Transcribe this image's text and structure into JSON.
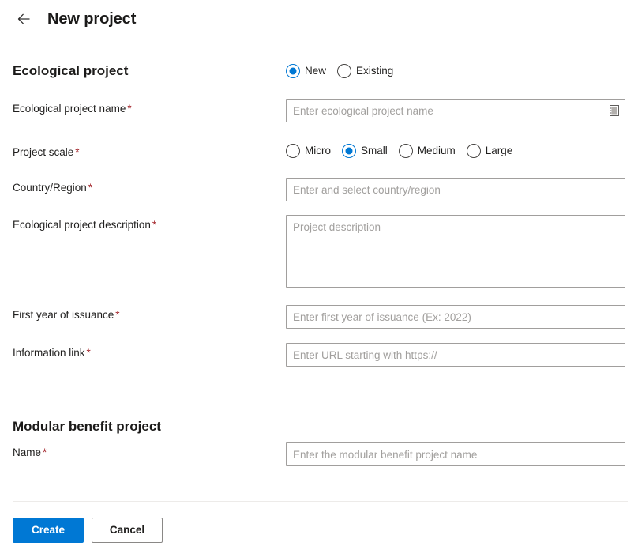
{
  "header": {
    "back_icon": "arrow-left-icon",
    "title": "New project"
  },
  "sections": {
    "ecological": {
      "heading": "Ecological project",
      "mode_radio": {
        "name": "ecological-mode",
        "options": [
          {
            "label": "New",
            "selected": true
          },
          {
            "label": "Existing",
            "selected": false
          }
        ]
      },
      "fields": {
        "project_name": {
          "label": "Ecological project name",
          "required_mark": "*",
          "value": "",
          "placeholder": "Enter ecological project name",
          "trailing_icon": "book-contacts-icon"
        },
        "project_scale": {
          "label": "Project scale",
          "required_mark": "*",
          "options": [
            {
              "label": "Micro",
              "selected": false
            },
            {
              "label": "Small",
              "selected": true
            },
            {
              "label": "Medium",
              "selected": false
            },
            {
              "label": "Large",
              "selected": false
            }
          ]
        },
        "country_region": {
          "label": "Country/Region",
          "required_mark": "*",
          "value": "",
          "placeholder": "Enter and select country/region"
        },
        "description": {
          "label": "Ecological project description",
          "required_mark": "*",
          "value": "",
          "placeholder": "Project description"
        },
        "first_year": {
          "label": "First year of issuance",
          "required_mark": "*",
          "value": "",
          "placeholder": "Enter first year of issuance (Ex: 2022)"
        },
        "information_link": {
          "label": "Information link",
          "required_mark": "*",
          "value": "",
          "placeholder": "Enter URL starting with https://"
        }
      }
    },
    "modular": {
      "heading": "Modular benefit project",
      "fields": {
        "name": {
          "label": "Name",
          "required_mark": "*",
          "value": "",
          "placeholder": "Enter the modular benefit project name"
        }
      }
    }
  },
  "footer": {
    "create_label": "Create",
    "cancel_label": "Cancel"
  },
  "colors": {
    "accent": "#0078d4",
    "required": "#a4262c",
    "border": "#a19f9d",
    "placeholder": "#a19f9d",
    "divider": "#edebe9"
  }
}
